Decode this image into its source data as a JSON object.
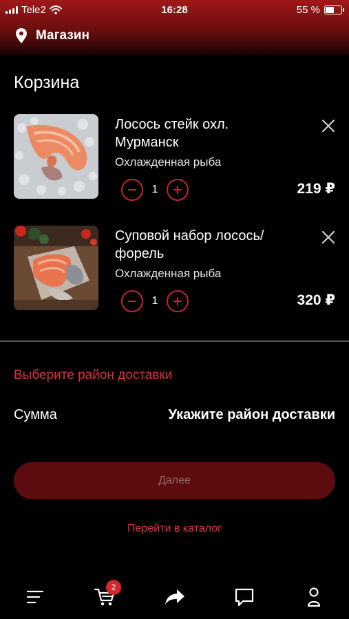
{
  "status_bar": {
    "carrier": "Tele2",
    "time": "16:28",
    "battery": "55 %",
    "battery_level": 0.55
  },
  "header": {
    "location_icon": "location-pin-icon",
    "location": "Магазин"
  },
  "cart": {
    "title": "Корзина",
    "items": [
      {
        "name": "Лосось стейк охл. Мурманск",
        "category": "Охлажденная рыба",
        "quantity": "1",
        "price": "219 ₽",
        "image": "salmon-steak-image"
      },
      {
        "name": "Суповой набор лосось/форель",
        "category": "Охлажденная рыба",
        "quantity": "1",
        "price": "320 ₽",
        "image": "soup-set-image"
      }
    ]
  },
  "delivery": {
    "district_prompt": "Выберите район доставки",
    "sum_label": "Сумма",
    "sum_value": "Укажите район доставки"
  },
  "actions": {
    "next_label": "Далее",
    "catalog_link": "Перейти в каталог"
  },
  "tabbar": {
    "cart_badge": "2",
    "icons": [
      "menu-icon",
      "cart-icon",
      "share-icon",
      "chat-icon",
      "profile-icon"
    ]
  },
  "colors": {
    "accent": "#d7323a",
    "header_top": "#a01818",
    "button_bg": "#5c0c0f",
    "background": "#000000"
  }
}
